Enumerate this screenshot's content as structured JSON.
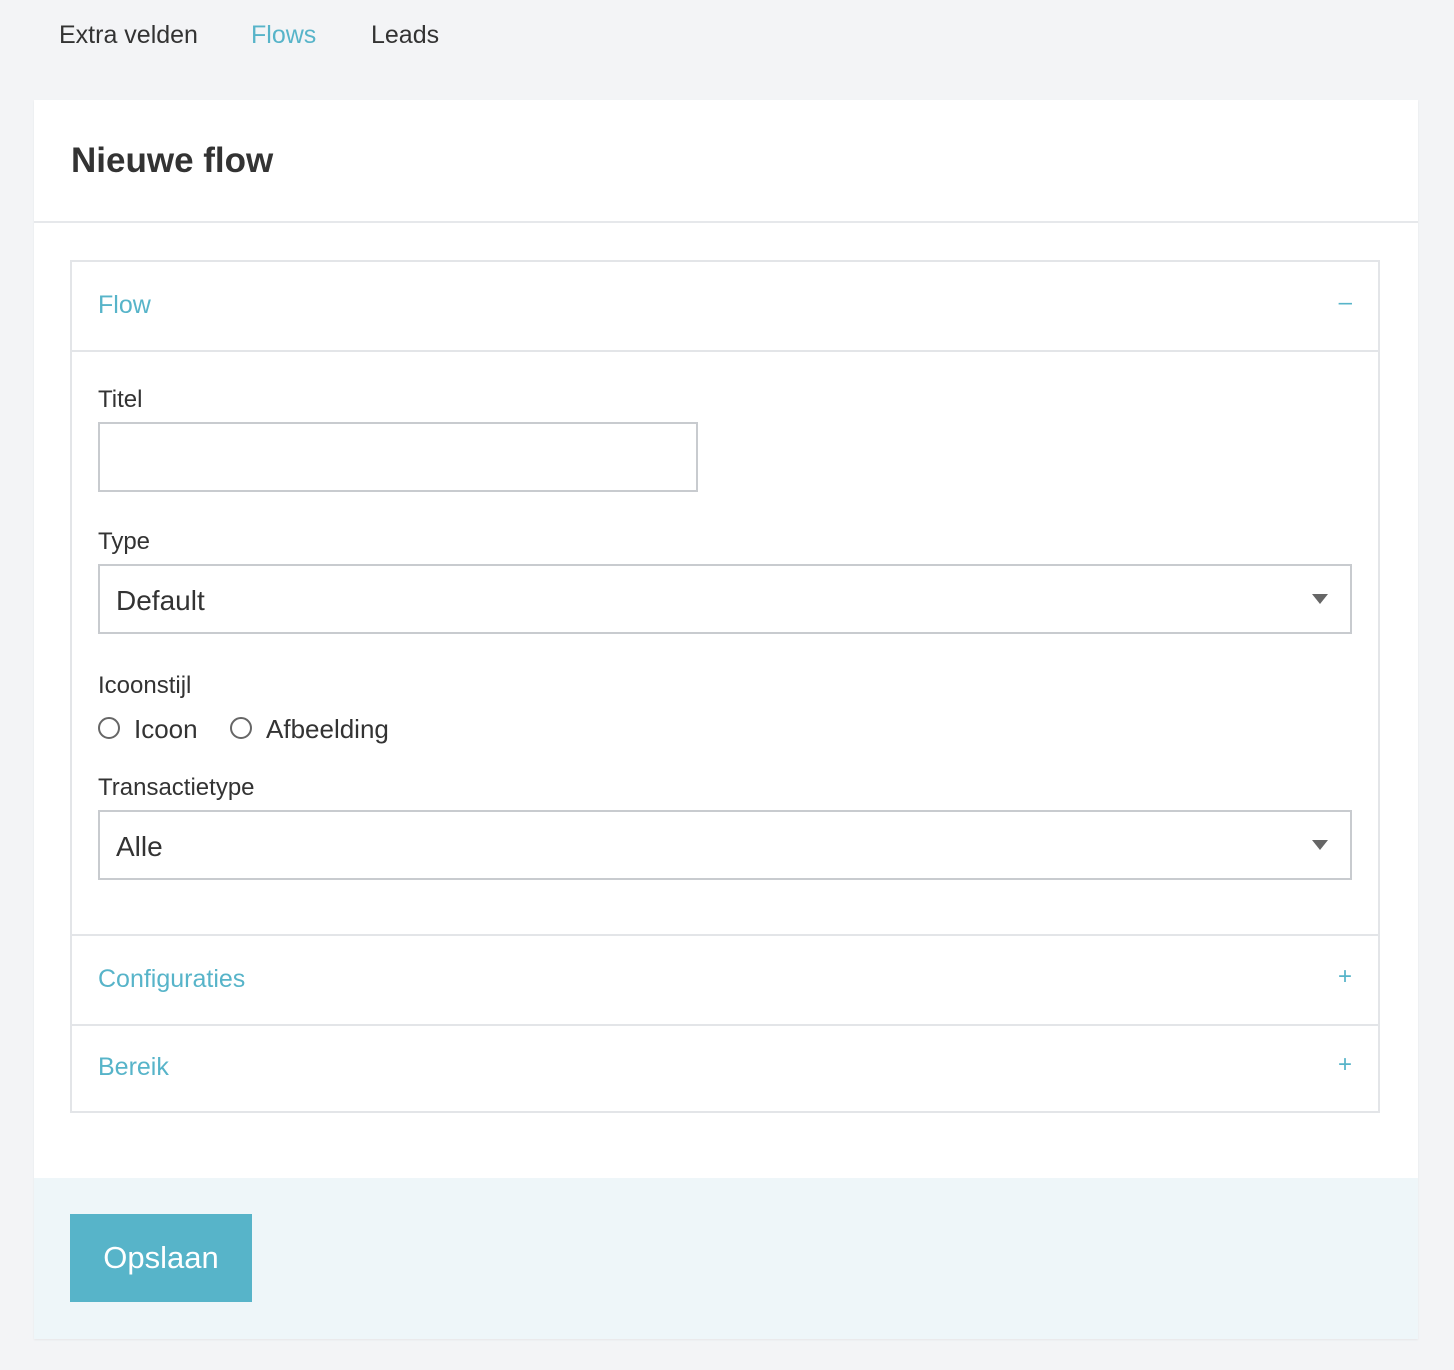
{
  "nav": {
    "items": [
      {
        "label": "Extra velden",
        "active": false
      },
      {
        "label": "Flows",
        "active": true
      },
      {
        "label": "Leads",
        "active": false
      }
    ]
  },
  "card": {
    "title": "Nieuwe flow"
  },
  "accordion": {
    "sections": [
      {
        "title": "Flow",
        "toggle": "–",
        "expanded": true
      },
      {
        "title": "Configuraties",
        "toggle": "+",
        "expanded": false
      },
      {
        "title": "Bereik",
        "toggle": "+",
        "expanded": false
      }
    ]
  },
  "form": {
    "titel": {
      "label": "Titel",
      "value": ""
    },
    "type": {
      "label": "Type",
      "selected": "Default"
    },
    "icoonstijl": {
      "label": "Icoonstijl",
      "options": [
        {
          "label": "Icoon",
          "checked": false
        },
        {
          "label": "Afbeelding",
          "checked": false
        }
      ]
    },
    "transactietype": {
      "label": "Transactietype",
      "selected": "Alle"
    }
  },
  "footer": {
    "save_label": "Opslaan"
  },
  "colors": {
    "accent": "#57b4c9",
    "text": "#333333",
    "page_bg": "#f3f4f6",
    "footer_bg": "#eef6f9"
  }
}
